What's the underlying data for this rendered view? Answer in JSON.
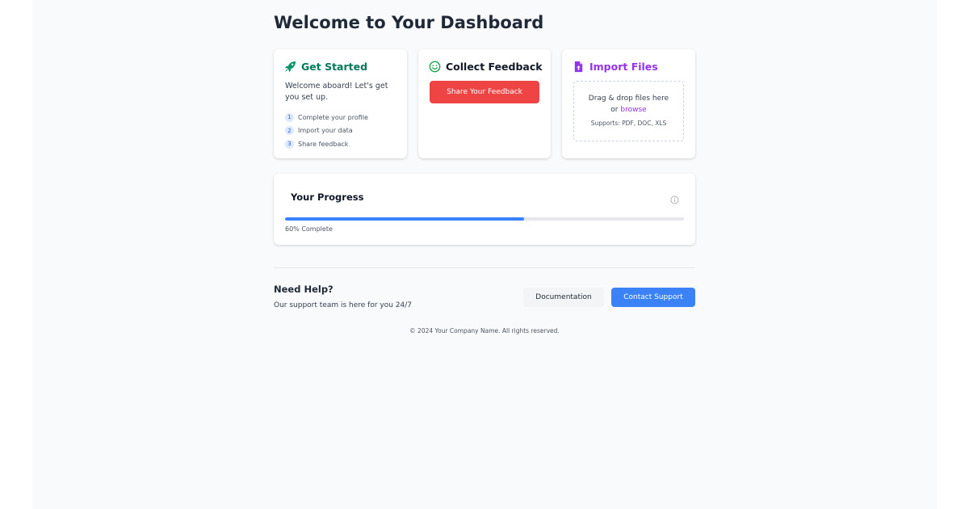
{
  "header": {
    "title": "Welcome to Your Dashboard"
  },
  "cards": {
    "get_started": {
      "title": "Get Started",
      "icon": "rocket-icon",
      "welcome": "Welcome aboard! Let's get you set up.",
      "steps": [
        {
          "num": "1",
          "label": "Complete your profile"
        },
        {
          "num": "2",
          "label": "Import your data"
        },
        {
          "num": "3",
          "label": "Share feedback"
        }
      ]
    },
    "feedback": {
      "title": "Collect Feedback",
      "icon": "smile-icon",
      "button": "Share Your Feedback"
    },
    "import": {
      "title": "Import Files",
      "icon": "file-upload-icon",
      "drop_text": "Drag & drop files here",
      "or": "or",
      "browse": "browse",
      "supports": "Supports: PDF, DOC, XLS"
    }
  },
  "progress": {
    "title": "Your Progress",
    "icon": "info-icon",
    "percent": 60,
    "label": "60% Complete"
  },
  "help": {
    "title": "Need Help?",
    "subtitle": "Our support team is here for you 24/7",
    "documentation_button": "Documentation",
    "contact_button": "Contact Support"
  },
  "footer": {
    "copyright": "© 2024 Your Company Name. All rights reserved."
  },
  "colors": {
    "green": "#047857",
    "purple": "#9333ea",
    "red": "#ef4444",
    "blue": "#3b82f6"
  }
}
